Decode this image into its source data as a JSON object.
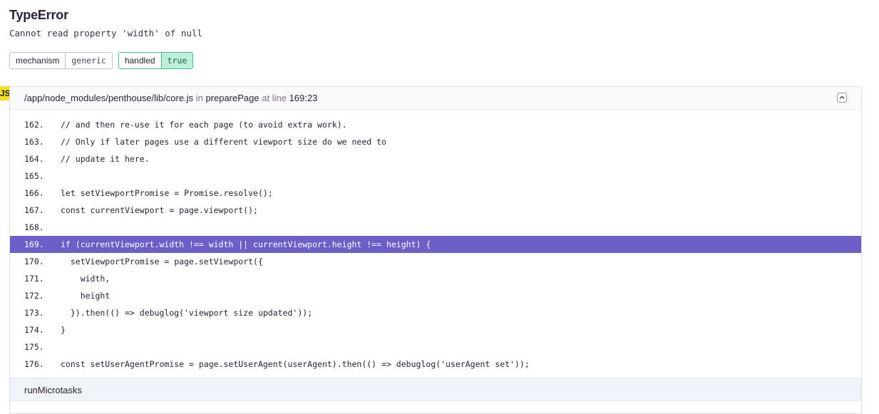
{
  "exception": {
    "type": "TypeError",
    "message": "Cannot read property 'width' of null"
  },
  "tags": [
    {
      "key": "mechanism",
      "value": "generic"
    },
    {
      "key": "handled",
      "value": "true"
    }
  ],
  "platform_badge": "JS",
  "frame": {
    "file": "/app/node_modules/penthouse/lib/core.js",
    "in_label": "in",
    "function": "preparePage",
    "at_line_label": "at line",
    "line_col": "169:23",
    "collapse_icon": "chevron-up-icon",
    "code_lines": [
      {
        "num": "162.",
        "code": "// and then re-use it for each page (to avoid extra work)."
      },
      {
        "num": "163.",
        "code": "// Only if later pages use a different viewport size do we need to"
      },
      {
        "num": "164.",
        "code": "// update it here."
      },
      {
        "num": "165.",
        "code": ""
      },
      {
        "num": "166.",
        "code": "let setViewportPromise = Promise.resolve();"
      },
      {
        "num": "167.",
        "code": "const currentViewport = page.viewport();"
      },
      {
        "num": "168.",
        "code": ""
      },
      {
        "num": "169.",
        "code": "if (currentViewport.width !== width || currentViewport.height !== height) {"
      },
      {
        "num": "170.",
        "code": "  setViewportPromise = page.setViewport({"
      },
      {
        "num": "171.",
        "code": "    width,"
      },
      {
        "num": "172.",
        "code": "    height"
      },
      {
        "num": "173.",
        "code": "  }).then(() => debuglog('viewport size updated'));"
      },
      {
        "num": "174.",
        "code": "}"
      },
      {
        "num": "175.",
        "code": ""
      },
      {
        "num": "176.",
        "code": "const setUserAgentPromise = page.setUserAgent(userAgent).then(() => debuglog('userAgent set'));"
      }
    ],
    "active_line": "169."
  },
  "next_frame": {
    "function": "runMicrotasks"
  },
  "colors": {
    "highlight": "#6c5fc7",
    "handled_bg": "#bdeed8",
    "badge_js": "#f7df1e"
  }
}
